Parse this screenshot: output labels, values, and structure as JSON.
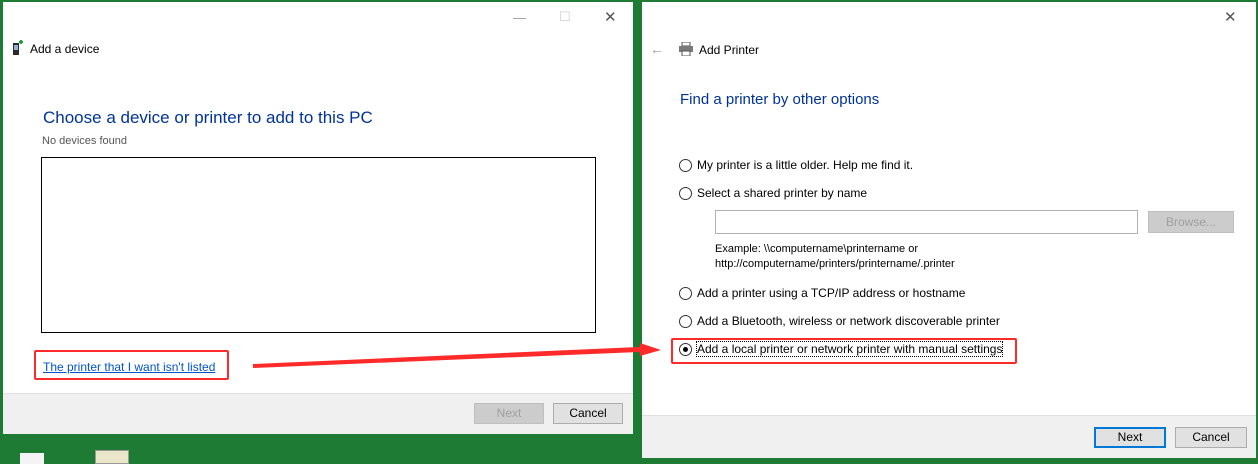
{
  "add_device": {
    "title": "Add a device",
    "heading": "Choose a device or printer to add to this PC",
    "status": "No devices found",
    "link": "The printer that I want isn't listed",
    "next_label": "Next",
    "cancel_label": "Cancel"
  },
  "add_printer": {
    "title": "Add Printer",
    "heading": "Find a printer by other options",
    "options": [
      {
        "label": "My printer is a little older. Help me find it.",
        "checked": false
      },
      {
        "label": "Select a shared printer by name",
        "checked": false
      },
      {
        "label": "Add a printer using a TCP/IP address or hostname",
        "checked": false
      },
      {
        "label": "Add a Bluetooth, wireless or network discoverable printer",
        "checked": false
      },
      {
        "label": "Add a local printer or network printer with manual settings",
        "checked": true
      }
    ],
    "shared_printer_value": "",
    "browse_label": "Browse...",
    "example_line1": "Example: \\\\computername\\printername or",
    "example_line2": "http://computername/printers/printername/.printer",
    "next_label": "Next",
    "cancel_label": "Cancel"
  },
  "annotation_color": "#ff2b2b"
}
